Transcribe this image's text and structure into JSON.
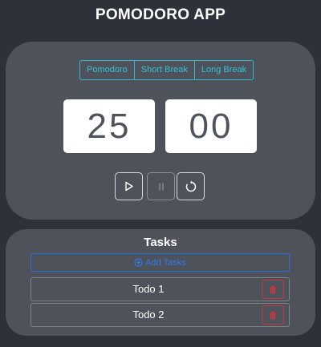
{
  "app": {
    "title": "POMODORO APP"
  },
  "timer": {
    "modes": [
      "Pomodoro",
      "Short Break",
      "Long Break"
    ],
    "minutes": "25",
    "seconds": "00",
    "controls": {
      "play_icon": "play-icon",
      "pause_icon": "pause-icon",
      "reset_icon": "reset-icon"
    }
  },
  "tasks": {
    "title": "Tasks",
    "add_label": "Add Tasks",
    "items": [
      {
        "label": "Todo 1",
        "delete_icon": "trash-icon"
      },
      {
        "label": "Todo 2",
        "delete_icon": "trash-icon"
      }
    ]
  },
  "colors": {
    "background": "#2d3139",
    "card": "#4e525b",
    "accent_cyan": "#38bfd6",
    "accent_blue": "#2f7bf0",
    "danger": "#c9363f"
  }
}
